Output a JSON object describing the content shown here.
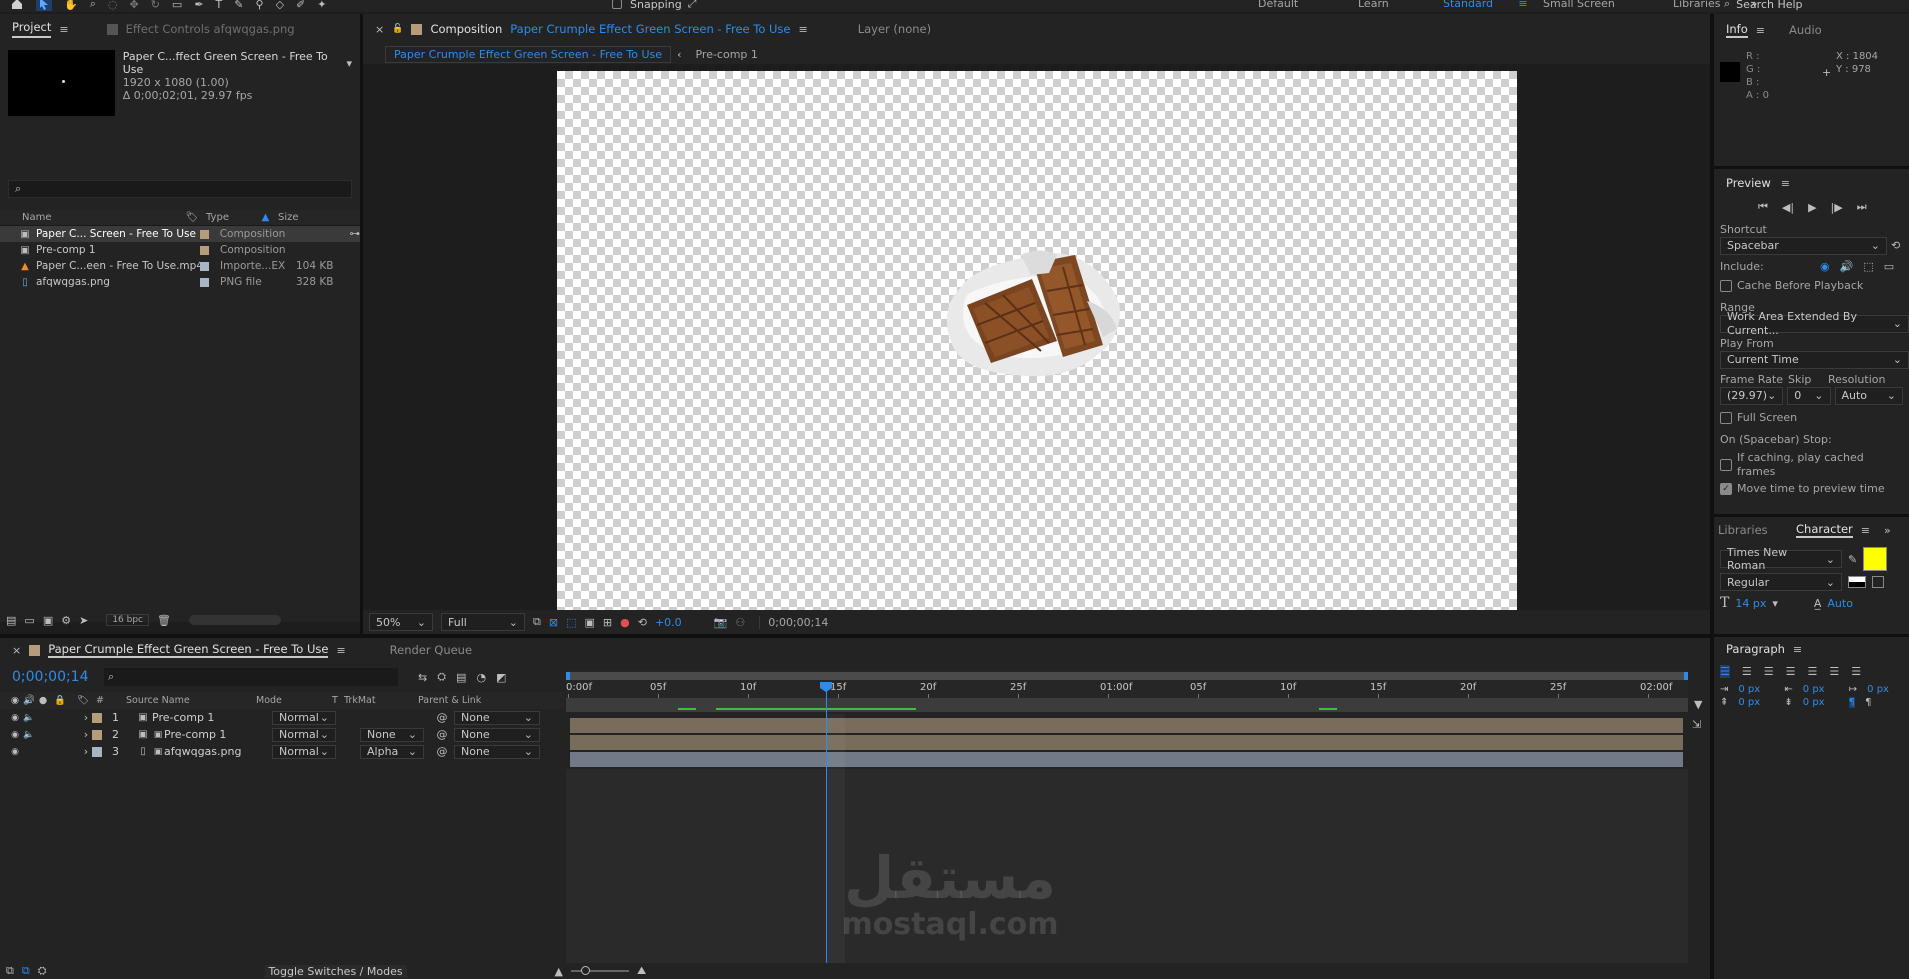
{
  "topbar": {
    "workspaces": [
      "Default",
      "Learn",
      "Standard",
      "Small Screen",
      "Libraries"
    ],
    "active_workspace": "Standard",
    "snapping": "Snapping",
    "search_placeholder": "Search Help"
  },
  "project": {
    "tab": "Project",
    "effect_tab": "Effect Controls afqwqgas.png",
    "comp_name": "Paper C...ffect Green Screen - Free To Use",
    "comp_res": "1920 x 1080 (1.00)",
    "comp_dur": "Δ 0;00;02;01, 29.97 fps",
    "columns": {
      "name": "Name",
      "type": "Type",
      "size": "Size"
    },
    "items": [
      {
        "name": "Paper C... Screen - Free To Use",
        "type": "Composition",
        "size": "",
        "color": "#b59d7c",
        "icon": "composition-icon"
      },
      {
        "name": "Pre-comp 1",
        "type": "Composition",
        "size": "",
        "color": "#b59d7c",
        "icon": "composition-icon"
      },
      {
        "name": "Paper C...een - Free To Use.mp4",
        "type": "Importe...EX",
        "size": "104 KB",
        "color": "#a8b5c2",
        "icon": "vlc-icon"
      },
      {
        "name": "afqwqgas.png",
        "type": "PNG file",
        "size": "328 KB",
        "color": "#a8b5c2",
        "icon": "png-file-icon"
      }
    ],
    "bpc": "16 bpc"
  },
  "composition": {
    "tab_prefix": "Composition",
    "tab_name": "Paper Crumple Effect Green Screen - Free To Use",
    "layer_tab": "Layer (none)",
    "breadcrumb_active": "Paper Crumple Effect Green Screen - Free To Use",
    "breadcrumb_next": "Pre-comp 1",
    "zoom": "50%",
    "resolution": "Full",
    "exposure": "+0.0",
    "timecode": "0;00;00;14"
  },
  "info": {
    "tab": "Info",
    "audio_tab": "Audio",
    "r": "R :",
    "g": "G :",
    "b": "B :",
    "a": "A : 0",
    "x": "X : 1804",
    "y": "Y : 978"
  },
  "preview": {
    "title": "Preview",
    "shortcut_label": "Shortcut",
    "shortcut": "Spacebar",
    "include": "Include:",
    "cache": "Cache Before Playback",
    "range_label": "Range",
    "range": "Work Area Extended By Current...",
    "play_from_label": "Play From",
    "play_from": "Current Time",
    "frame_rate_label": "Frame Rate",
    "skip_label": "Skip",
    "resolution_label": "Resolution",
    "frame_rate": "(29.97)",
    "skip": "0",
    "resolution": "Auto",
    "full_screen": "Full Screen",
    "stop_label": "On (Spacebar) Stop:",
    "if_caching": "If caching, play cached frames",
    "move_time": "Move time to preview time"
  },
  "character": {
    "libraries_tab": "Libraries",
    "tab": "Character",
    "font": "Times New Roman",
    "style": "Regular",
    "size": "14 px",
    "leading": "Auto",
    "fill_color": "#ffff00"
  },
  "paragraph": {
    "tab": "Paragraph",
    "values": [
      "0 px",
      "0 px",
      "0 px",
      "0 px",
      "0 px"
    ]
  },
  "timeline": {
    "tab": "Paper Crumple Effect Green Screen - Free To Use",
    "render_queue": "Render Queue",
    "timecode": "0;00;00;14",
    "columns": {
      "num": "#",
      "source": "Source Name",
      "mode": "Mode",
      "t": "T",
      "trkmat": "TrkMat",
      "parent": "Parent & Link"
    },
    "ruler": [
      "0:00f",
      "05f",
      "10f",
      "15f",
      "20f",
      "25f",
      "01:00f",
      "05f",
      "10f",
      "15f",
      "20f",
      "25f",
      "02:00f"
    ],
    "layers": [
      {
        "num": "1",
        "name": "Pre-comp 1",
        "mode": "Normal",
        "trkmat": "",
        "parent": "None",
        "color": "#b59d7c"
      },
      {
        "num": "2",
        "name": "Pre-comp 1",
        "mode": "Normal",
        "trkmat": "None",
        "parent": "None",
        "color": "#b59d7c"
      },
      {
        "num": "3",
        "name": "afqwqgas.png",
        "mode": "Normal",
        "trkmat": "Alpha",
        "parent": "None",
        "color": "#a8b5c2"
      }
    ],
    "toggle": "Toggle Switches / Modes"
  },
  "watermark": {
    "arabic": "مستقل",
    "latin": "mostaql.com"
  }
}
